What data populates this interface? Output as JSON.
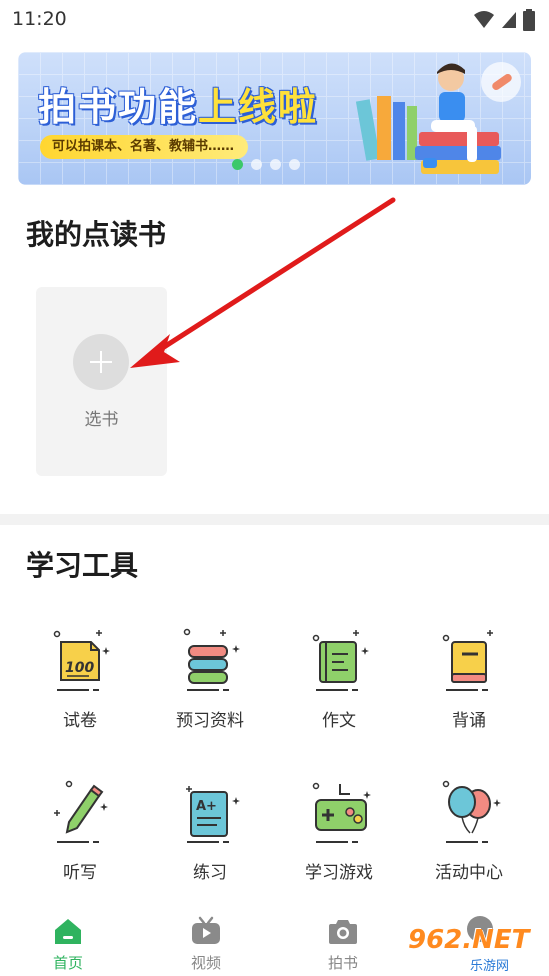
{
  "status_bar": {
    "time": "11:20"
  },
  "banner": {
    "title_white": "拍书功能",
    "title_yellow": "上线啦",
    "subtitle": "可以拍课本、名著、教辅书……"
  },
  "my_books": {
    "title": "我的点读书",
    "add_label": "选书"
  },
  "tools": {
    "title": "学习工具",
    "items": [
      {
        "label": "试卷",
        "icon": "exam-paper-icon"
      },
      {
        "label": "预习资料",
        "icon": "books-stack-icon"
      },
      {
        "label": "作文",
        "icon": "composition-book-icon"
      },
      {
        "label": "背诵",
        "icon": "recite-book-icon"
      },
      {
        "label": "听写",
        "icon": "pen-icon"
      },
      {
        "label": "练习",
        "icon": "practice-sheet-icon"
      },
      {
        "label": "学习游戏",
        "icon": "gamepad-icon"
      },
      {
        "label": "活动中心",
        "icon": "balloons-icon"
      }
    ]
  },
  "bottom_nav": {
    "items": [
      {
        "label": "首页",
        "icon": "home-icon"
      },
      {
        "label": "视频",
        "icon": "tv-icon"
      },
      {
        "label": "拍书",
        "icon": "camera-icon"
      }
    ]
  },
  "watermark": {
    "main": "962.NET",
    "sub": "乐游网"
  },
  "colors": {
    "accent_green": "#2fb35f",
    "banner_blue": "#2d5fd6",
    "banner_yellow": "#ffe13a"
  }
}
